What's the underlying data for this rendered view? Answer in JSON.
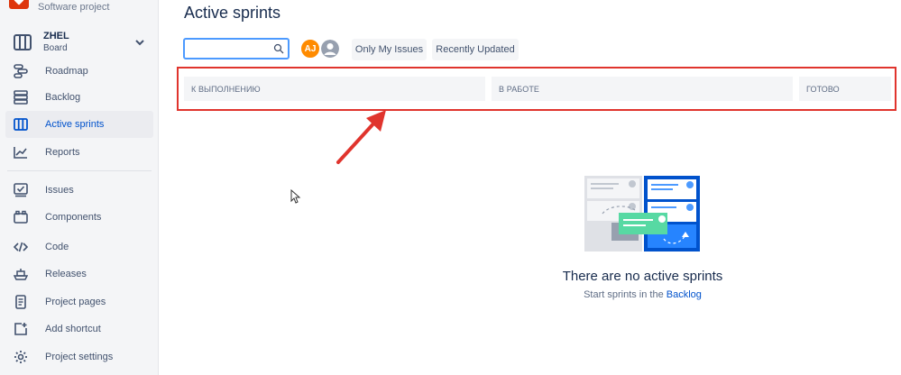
{
  "sidebar": {
    "project_type": "Software project",
    "board": {
      "name": "ZHEL",
      "sub": "Board"
    },
    "items": [
      {
        "label": "Roadmap"
      },
      {
        "label": "Backlog"
      },
      {
        "label": "Active sprints"
      },
      {
        "label": "Reports"
      },
      {
        "label": "Issues"
      },
      {
        "label": "Components"
      },
      {
        "label": "Code"
      },
      {
        "label": "Releases"
      },
      {
        "label": "Project pages"
      },
      {
        "label": "Add shortcut"
      },
      {
        "label": "Project settings"
      }
    ],
    "active_index": 2
  },
  "main": {
    "title": "Active sprints",
    "search": {
      "value": "",
      "placeholder": ""
    },
    "avatar_initials": "AJ",
    "filters": [
      "Only My Issues",
      "Recently Updated"
    ],
    "columns": [
      "К ВЫПОЛНЕНИЮ",
      "В РАБОТЕ",
      "ГОТОВО"
    ],
    "empty_state": {
      "title": "There are no active sprints",
      "subtitle": "Start sprints in the",
      "link": "Backlog"
    }
  },
  "colors": {
    "accent": "#0052cc",
    "highlight": "#e0342d",
    "avatar": "#ff8b00",
    "sidebar_bg": "#f4f5f7"
  }
}
